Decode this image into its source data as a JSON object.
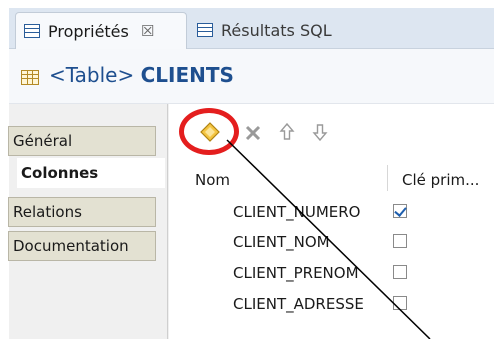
{
  "tabs": [
    {
      "label": "Propriétés",
      "close": "☒"
    },
    {
      "label": "Résultats SQL"
    }
  ],
  "header": {
    "prefix": "<Table>",
    "name": "CLIENTS"
  },
  "sidebar": {
    "items": [
      {
        "label": "Général"
      },
      {
        "label": "Colonnes"
      },
      {
        "label": "Relations"
      },
      {
        "label": "Documentation"
      }
    ]
  },
  "toolbar": {
    "icons": [
      "add-column-icon",
      "delete-icon",
      "move-up-icon",
      "move-down-icon"
    ]
  },
  "table": {
    "headers": {
      "nom": "Nom",
      "cle": "Clé prim..."
    },
    "rows": [
      {
        "name": "CLIENT_NUMERO",
        "primary_key": true
      },
      {
        "name": "CLIENT_NOM",
        "primary_key": false
      },
      {
        "name": "CLIENT_PRENOM",
        "primary_key": false
      },
      {
        "name": "CLIENT_ADRESSE",
        "primary_key": false
      }
    ]
  },
  "colors": {
    "annotation": "#e41e1e",
    "title": "#1e4f8f",
    "tab_bar": "#dde6f1"
  }
}
